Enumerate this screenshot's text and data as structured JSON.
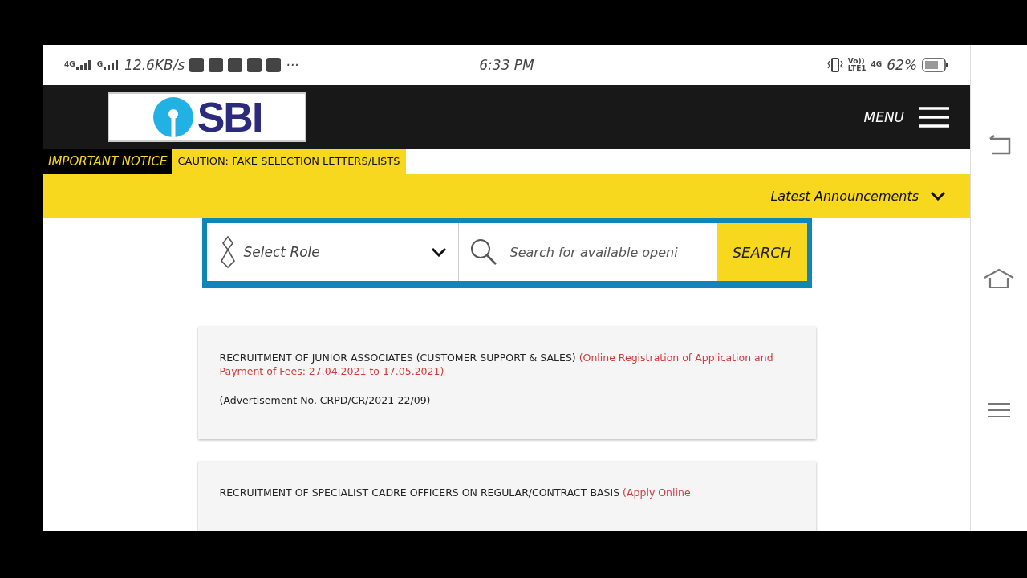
{
  "status_bar": {
    "network_labels": [
      "4G",
      "G"
    ],
    "speed": "12.6KB/s",
    "more": "···",
    "time": "6:33 PM",
    "volte": "Vo))",
    "lte": "LTE1",
    "data_label": "4G",
    "battery": "62%"
  },
  "header": {
    "logo_text": "SBI",
    "menu_label": "MENU"
  },
  "notice": {
    "label": "IMPORTANT NOTICE",
    "text": "CAUTION: FAKE SELECTION LETTERS/LISTS"
  },
  "announcements": {
    "label": "Latest Announcements",
    "expanded": false
  },
  "search": {
    "role_placeholder": "Select Role",
    "placeholder": "Search for available openi",
    "button": "SEARCH"
  },
  "cards": [
    {
      "title": "RECRUITMENT OF JUNIOR ASSOCIATES (CUSTOMER SUPPORT & SALES)",
      "note": "(Online Registration of Application and Payment of Fees: 27.04.2021 to 17.05.2021)",
      "detail": "(Advertisement No. CRPD/CR/2021-22/09)"
    },
    {
      "title": "RECRUITMENT OF SPECIALIST CADRE OFFICERS ON REGULAR/CONTRACT BASIS",
      "note": "(Apply Online"
    }
  ]
}
